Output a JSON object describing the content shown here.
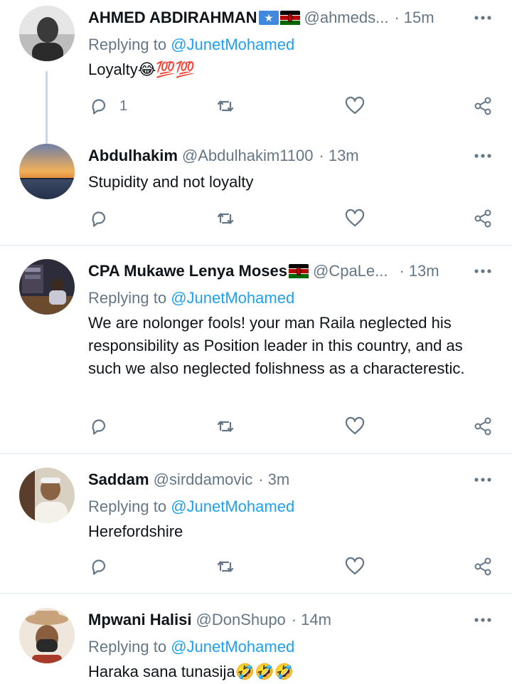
{
  "tweets": [
    {
      "name": "AHMED ABDIRAHMAN",
      "flags": [
        "somalia-flag",
        "kenya-flag"
      ],
      "handle": "@ahmeds...",
      "time": "15m",
      "replying_label": "Replying to",
      "replying_to": "@JunetMohamed",
      "text": "Loyalty😂💯💯",
      "reply_count": "1",
      "avatar_colors": [
        "#4a4a4a",
        "#cfcfcf"
      ]
    },
    {
      "name": "Abdulhakim",
      "flags": [],
      "handle": "@Abdulhakim1100",
      "time": "13m",
      "replying_label": "",
      "replying_to": "",
      "text": "Stupidity and not loyalty",
      "reply_count": "",
      "avatar_colors": [
        "#f0a040",
        "#3b4a66"
      ]
    },
    {
      "name": "CPA Mukawe Lenya Moses",
      "flags": [
        "kenya-flag"
      ],
      "handle": "@CpaLe...",
      "time": "13m",
      "replying_label": "Replying to",
      "replying_to": "@JunetMohamed",
      "text": "We are nolonger fools! your man Raila  neglected his responsibility as Position leader in this country, and as such we also neglected folishness as a characterestic.",
      "reply_count": "",
      "avatar_colors": [
        "#2c2c3a",
        "#8a7a60"
      ]
    },
    {
      "name": "Saddam",
      "flags": [],
      "handle": "@sirddamovic",
      "time": "3m",
      "replying_label": "Replying to",
      "replying_to": "@JunetMohamed",
      "text": "Herefordshire",
      "reply_count": "",
      "avatar_colors": [
        "#d8d0c0",
        "#5a3e2b"
      ]
    },
    {
      "name": "Mpwani Halisi",
      "flags": [],
      "handle": "@DonShupo",
      "time": "14m",
      "replying_label": "Replying to",
      "replying_to": "@JunetMohamed",
      "text": "Haraka sana tunasija🤣🤣🤣",
      "reply_count": "",
      "avatar_colors": [
        "#c8a27a",
        "#2a2a2a"
      ]
    }
  ],
  "separator": "·",
  "icons": {
    "reply": "reply-bubble-icon",
    "retweet": "retweet-icon",
    "like": "heart-icon",
    "share": "share-icon",
    "more": "more-dots-icon"
  },
  "colors": {
    "link": "#1da1f2",
    "muted": "#657786",
    "divider": "#e1e8ed"
  }
}
